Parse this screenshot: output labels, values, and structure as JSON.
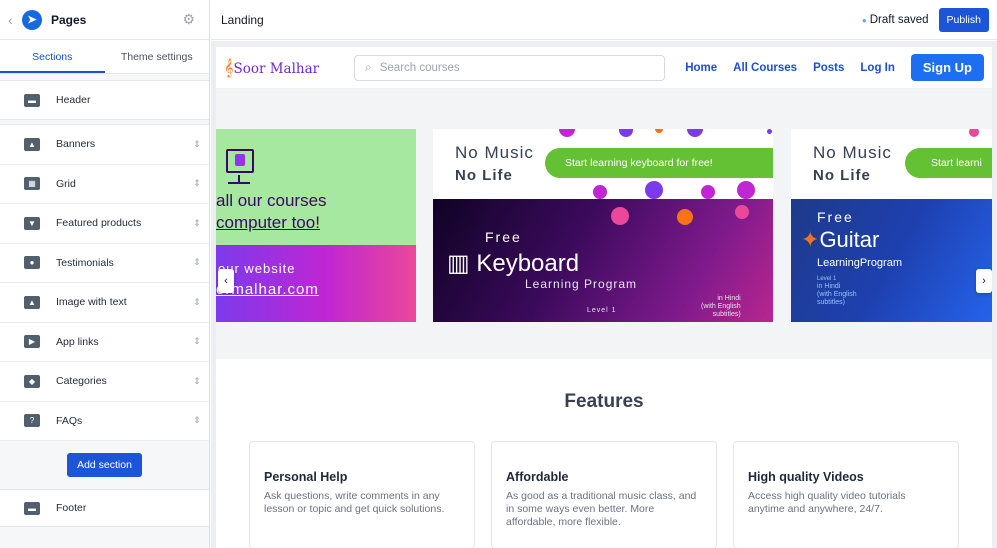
{
  "sidebar": {
    "title": "Pages",
    "tabs": [
      "Sections",
      "Theme settings"
    ],
    "header_label": "Header",
    "items": [
      {
        "label": "Banners",
        "icon": "image-icon"
      },
      {
        "label": "Grid",
        "icon": "grid-icon"
      },
      {
        "label": "Featured products",
        "icon": "cart-icon"
      },
      {
        "label": "Testimonials",
        "icon": "people-icon"
      },
      {
        "label": "Image with text",
        "icon": "image-text-icon"
      },
      {
        "label": "App links",
        "icon": "app-store-icon"
      },
      {
        "label": "Categories",
        "icon": "tag-icon"
      },
      {
        "label": "FAQs",
        "icon": "question-icon"
      }
    ],
    "add_section_label": "Add section",
    "footer_label": "Footer"
  },
  "topbar": {
    "page_name": "Landing",
    "status": "Draft saved",
    "publish_label": "Publish"
  },
  "site": {
    "brand": "Soor Malhar",
    "search_placeholder": "Search courses",
    "nav": [
      "Home",
      "All Courses",
      "Posts",
      "Log In"
    ],
    "signup_label": "Sign Up",
    "banners": {
      "a_line1": "all our courses",
      "a_line2": "computer too!",
      "a_line3": "our website",
      "a_line4": "ormalhar.com",
      "no_music": "No Music",
      "no_life": "No Life",
      "keyboard_pill": "Start learning keyboard for free!",
      "free": "Free",
      "keyboard": "Keyboard",
      "learning_program": "Learning Program",
      "level": "Level 1",
      "hindi_lines": [
        "in Hindi",
        "(with English",
        "subtitles)"
      ],
      "guitar_pill": "Start learni",
      "guitar": "Guitar",
      "guitar_lp": "LearningProgram"
    },
    "features_title": "Features",
    "features": [
      {
        "title": "Personal Help",
        "text": "Ask questions, write comments in any lesson or topic and get quick solutions."
      },
      {
        "title": "Affordable",
        "text": "As good as a traditional music class, and in some ways even better. More affordable, more flexible."
      },
      {
        "title": "High quality Videos",
        "text": "Access high quality video tutorials anytime and anywhere, 24/7."
      }
    ]
  },
  "colors": {
    "accent": "#1d55d8",
    "signup": "#1d6ef0",
    "pill_green": "#65c134",
    "brand_purple": "#6d28d9"
  }
}
